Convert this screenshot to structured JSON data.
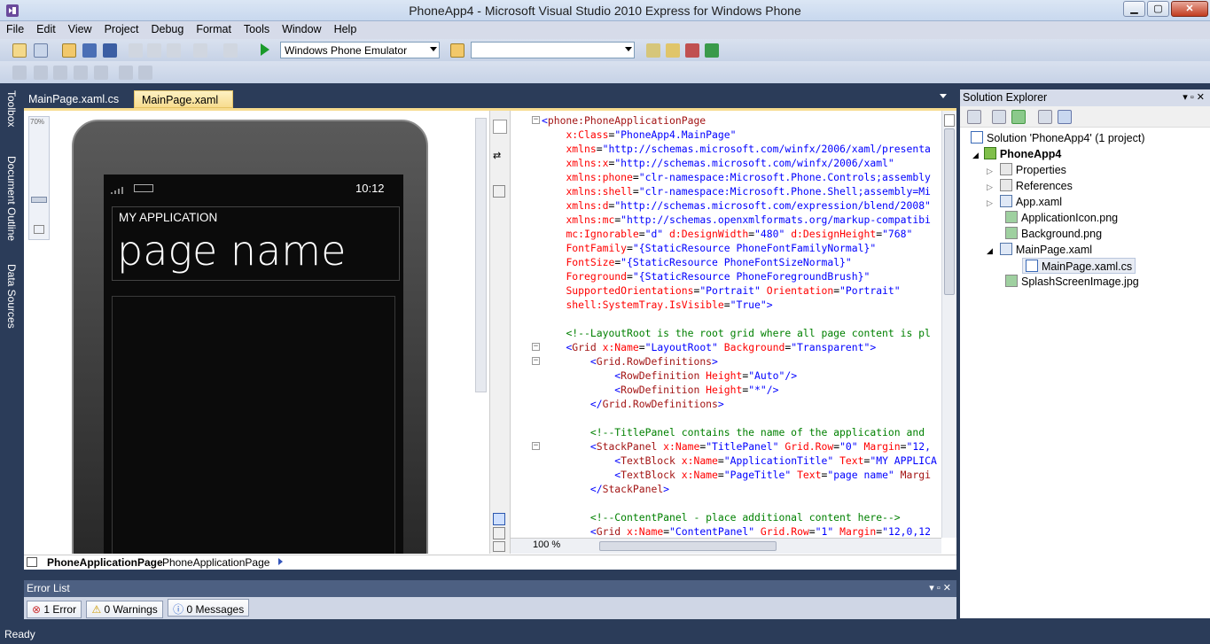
{
  "window": {
    "title": "PhoneApp4 - Microsoft Visual Studio 2010 Express for Windows Phone",
    "min": "▁",
    "max": "▢",
    "close": "✕"
  },
  "menu": [
    "File",
    "Edit",
    "View",
    "Project",
    "Debug",
    "Format",
    "Tools",
    "Window",
    "Help"
  ],
  "toolbar": {
    "target": "Windows Phone Emulator",
    "config": ""
  },
  "sidebar": {
    "toolbox": "Toolbox",
    "doc_outline": "Document Outline",
    "data_sources": "Data Sources"
  },
  "tabs": [
    {
      "label": "MainPage.xaml.cs"
    },
    {
      "label": "MainPage.xaml",
      "close": "✕"
    }
  ],
  "design": {
    "zoom": "70%",
    "phone": {
      "clock": "10:12",
      "app_title": "MY APPLICATION",
      "page_title": "page name"
    }
  },
  "code_lines": [
    [
      "<",
      "phone:PhoneApplicationPage"
    ],
    [
      "    x:Class=\"PhoneApp4.MainPage\""
    ],
    [
      "    xmlns=\"http://schemas.microsoft.com/winfx/2006/xaml/presenta"
    ],
    [
      "    xmlns:x=\"http://schemas.microsoft.com/winfx/2006/xaml\""
    ],
    [
      "    xmlns:phone=\"clr-namespace:Microsoft.Phone.Controls;assembly"
    ],
    [
      "    xmlns:shell=\"clr-namespace:Microsoft.Phone.Shell;assembly=Mi"
    ],
    [
      "    xmlns:d=\"http://schemas.microsoft.com/expression/blend/2008\""
    ],
    [
      "    xmlns:mc=\"http://schemas.openxmlformats.org/markup-compatibi"
    ],
    [
      "    mc:Ignorable=\"d\" d:DesignWidth=\"480\" d:DesignHeight=\"768\""
    ],
    [
      "    FontFamily=\"{StaticResource PhoneFontFamilyNormal}\""
    ],
    [
      "    FontSize=\"{StaticResource PhoneFontSizeNormal}\""
    ],
    [
      "    Foreground=\"{StaticResource PhoneForegroundBrush}\""
    ],
    [
      "    SupportedOrientations=\"Portrait\" Orientation=\"Portrait\""
    ],
    [
      "    shell:SystemTray.IsVisible=\"True\">"
    ],
    [
      ""
    ],
    [
      "    <!--LayoutRoot is the root grid where all page content is pl"
    ],
    [
      "    <Grid x:Name=\"LayoutRoot\" Background=\"Transparent\">"
    ],
    [
      "        <Grid.RowDefinitions>"
    ],
    [
      "            <RowDefinition Height=\"Auto\"/>"
    ],
    [
      "            <RowDefinition Height=\"*\"/>"
    ],
    [
      "        </Grid.RowDefinitions>"
    ],
    [
      ""
    ],
    [
      "        <!--TitlePanel contains the name of the application and"
    ],
    [
      "        <StackPanel x:Name=\"TitlePanel\" Grid.Row=\"0\" Margin=\"12,"
    ],
    [
      "            <TextBlock x:Name=\"ApplicationTitle\" Text=\"MY APPLICA"
    ],
    [
      "            <TextBlock x:Name=\"PageTitle\" Text=\"page name\" Margi"
    ],
    [
      "        </StackPanel>"
    ],
    [
      ""
    ],
    [
      "        <!--ContentPanel - place additional content here-->"
    ],
    [
      "        <Grid x:Name=\"ContentPanel\" Grid.Row=\"1\" Margin=\"12,0,12"
    ]
  ],
  "editor_zoom": "100 %",
  "breadcrumb": {
    "bold": "PhoneApplicationPage",
    "normal": "PhoneApplicationPage"
  },
  "error_list": {
    "title": "Error List",
    "errors": "1 Error",
    "warnings": "0 Warnings",
    "messages": "0 Messages"
  },
  "solution_explorer": {
    "title": "Solution Explorer",
    "items": [
      {
        "label": "Solution 'PhoneApp4' (1 project)",
        "level": 0
      },
      {
        "label": "PhoneApp4",
        "level": 1
      },
      {
        "label": "Properties",
        "level": 2
      },
      {
        "label": "References",
        "level": 2
      },
      {
        "label": "App.xaml",
        "level": 2
      },
      {
        "label": "ApplicationIcon.png",
        "level": 2
      },
      {
        "label": "Background.png",
        "level": 2
      },
      {
        "label": "MainPage.xaml",
        "level": 2
      },
      {
        "label": "MainPage.xaml.cs",
        "level": 3
      },
      {
        "label": "SplashScreenImage.jpg",
        "level": 2
      }
    ]
  },
  "status": "Ready"
}
